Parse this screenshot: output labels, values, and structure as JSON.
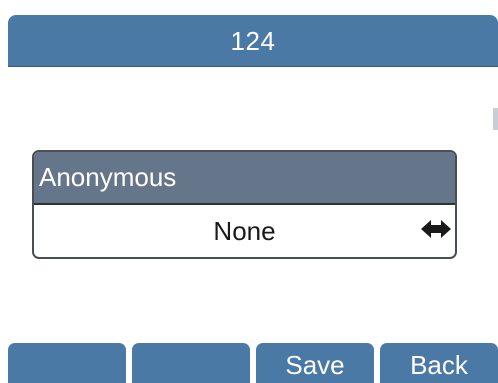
{
  "header": {
    "title": "124"
  },
  "setting": {
    "label": "Anonymous",
    "value": "None",
    "selector_icon": "left-right-arrow-icon"
  },
  "softkeys": [
    {
      "label": ""
    },
    {
      "label": ""
    },
    {
      "label": "Save"
    },
    {
      "label": "Back"
    }
  ],
  "colors": {
    "header_bg": "#4b79a6",
    "card_title_bg": "#66768a",
    "softkey_bg": "#4b79a6",
    "text_light": "#ffffff",
    "text_dark": "#1a1a1a"
  }
}
